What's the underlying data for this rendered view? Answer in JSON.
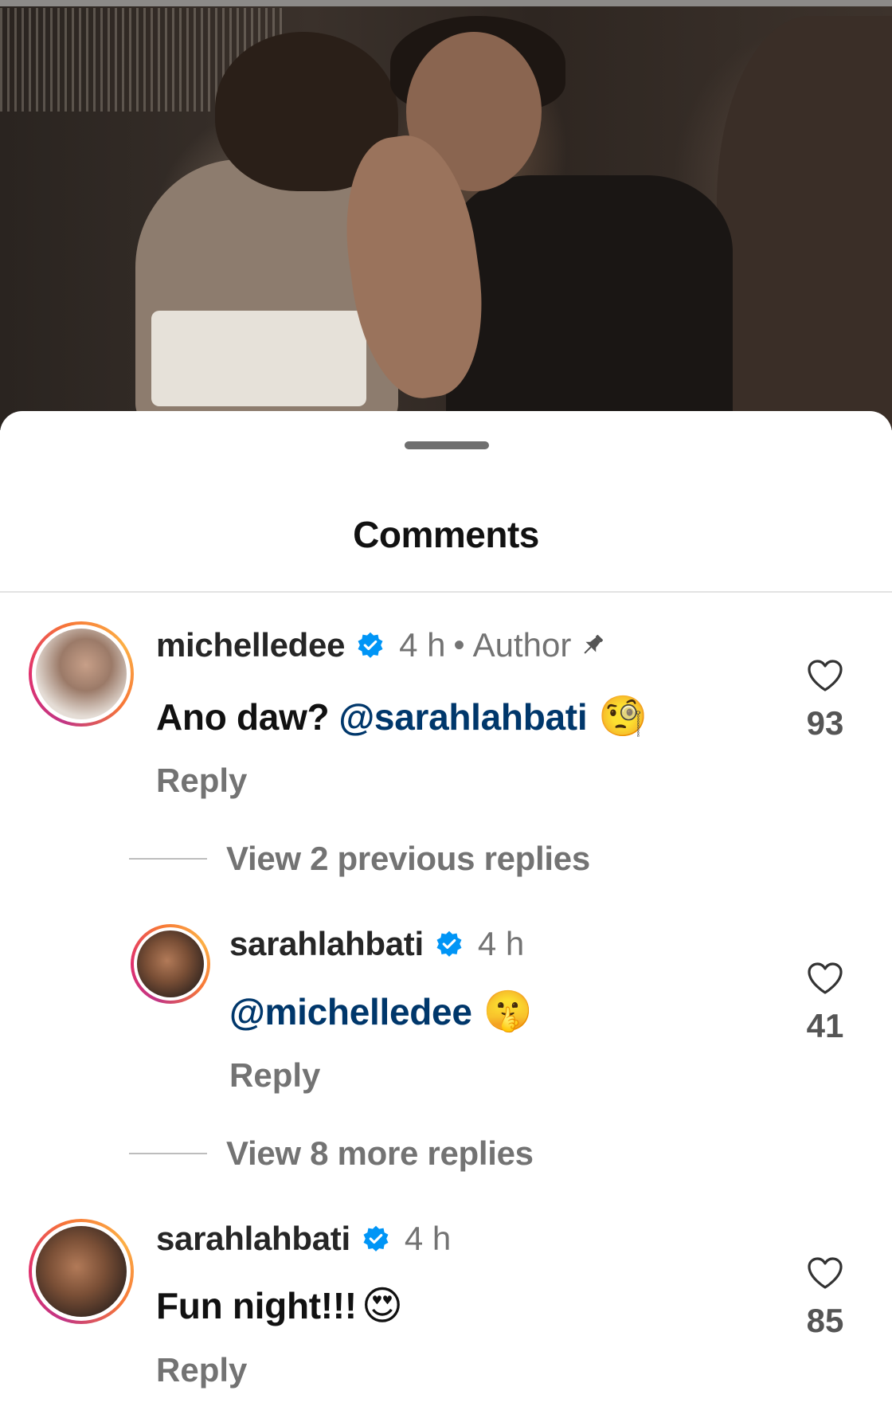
{
  "sheet": {
    "title": "Comments"
  },
  "comments": [
    {
      "username": "michelledee",
      "time": "4 h",
      "badge": "Author",
      "text": "Ano daw?",
      "mention": "@sarahlahbati",
      "emoji": "🧐",
      "reply_label": "Reply",
      "likes": "93",
      "view_replies": "View 2 previous replies"
    },
    {
      "username": "sarahlahbati",
      "time": "4 h",
      "mention": "@michelledee",
      "emoji": "🤫",
      "reply_label": "Reply",
      "likes": "41",
      "view_replies": "View 8 more replies"
    },
    {
      "username": "sarahlahbati",
      "time": "4 h",
      "text": "Fun night!!!",
      "emoji": "😍",
      "reply_label": "Reply",
      "likes": "85"
    }
  ],
  "icons": {
    "verified": "verified-badge-icon",
    "pin": "pin-icon",
    "like": "heart-icon"
  },
  "colors": {
    "mention": "#00376b",
    "verified": "#0095f6",
    "secondary_text": "#737373"
  }
}
